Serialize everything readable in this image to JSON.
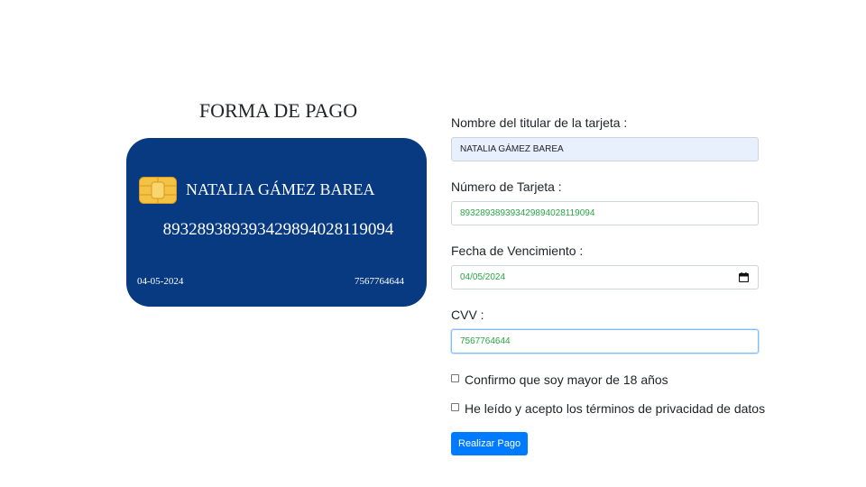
{
  "header": {
    "title": "FORMA DE PAGO"
  },
  "card": {
    "holder_name": "NATALIA GÁMEZ BAREA",
    "number": "8932893893934298940281190​94",
    "expiry": "04-05-2024",
    "cvv": "7567764644",
    "background_color": "#073a80",
    "chip_icon": "chip-icon"
  },
  "form": {
    "holder_label": "Nombre del titular de la tarjeta :",
    "holder_value": "NATALIA GÁMEZ BAREA",
    "number_label": "Número de Tarjeta :",
    "number_value": "893289389393429894028119094",
    "expiry_label": "Fecha de Vencimiento :",
    "expiry_value": "04/05/2024",
    "cvv_label": "CVV :",
    "cvv_value": "7567764644",
    "age_checkbox_label": "Confirmo que soy mayor de 18 años",
    "privacy_checkbox_label": "He leído y acepto los términos de privacidad de datos",
    "submit_label": "Realizar Pago",
    "accent_color": "#007bff",
    "valid_text_color": "#28a745"
  }
}
